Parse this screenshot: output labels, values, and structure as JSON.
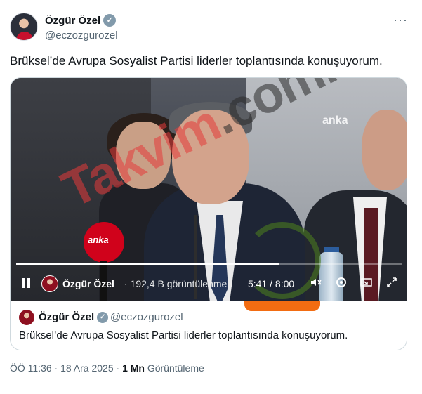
{
  "author": {
    "name": "Özgür Özel",
    "handle": "@eczozgurozel",
    "verified_icon": "check-badge-icon"
  },
  "menu": {
    "more_label": "···"
  },
  "tweet": {
    "text": "Brüksel’de Avrupa Sosyalist Partisi liderler toplantısında konuşuyorum."
  },
  "video": {
    "broadcaster_mark": "anka",
    "mic_label": "anka",
    "watermark_part1": "Takvim",
    "watermark_part2": ".com.tr",
    "progress": 0.68,
    "controls": {
      "channel_name": "Özgür Özel",
      "views": "· 192,4 B görüntülenme",
      "time": "5:41 / 8:00",
      "icons": [
        "pause-icon",
        "volume-icon",
        "settings-icon",
        "pip-icon",
        "fullscreen-icon"
      ]
    }
  },
  "quoted": {
    "name": "Özgür Özel",
    "handle": "@eczozgurozel",
    "text": "Brüksel’de Avrupa Sosyalist Partisi liderler toplantısında konuşuyorum."
  },
  "meta": {
    "time_date": "ÖÖ 11:36 · 18 Ara 2025 ·",
    "views_count": "1 Mn",
    "views_label": "Görüntüleme"
  },
  "colors": {
    "accent_orange": "#f26c12",
    "brand_red": "#d0021b",
    "muted_text": "#536471"
  }
}
